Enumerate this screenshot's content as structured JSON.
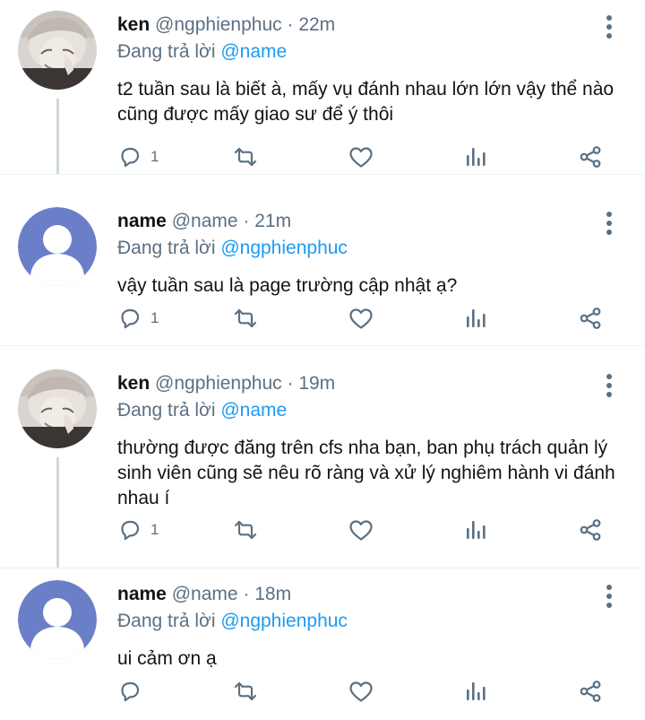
{
  "colors": {
    "accent": "#1d9bf0",
    "muted": "#5b7083",
    "thread_line": "#cfd9de"
  },
  "tweets": [
    {
      "name": "ken",
      "handle": "@ngphienphuc",
      "separator": "·",
      "time": "22m",
      "reply_prefix": "Đang trả lời",
      "reply_to": "@name",
      "text": "t2 tuần sau là biết à, mấy vụ đánh nhau lớn lớn vậy thể nào cũng được mấy giao sư để ý thôi",
      "reply_count": "1",
      "avatar": "photo-avatar"
    },
    {
      "name": "name",
      "handle": "@name",
      "separator": "·",
      "time": "21m",
      "reply_prefix": "Đang trả lời",
      "reply_to": "@ngphienphuc",
      "text": "vậy tuần sau là page trường cập nhật ạ?",
      "reply_count": "1",
      "avatar": "default-avatar"
    },
    {
      "name": "ken",
      "handle": "@ngphienphuc",
      "separator": "·",
      "time": "19m",
      "reply_prefix": "Đang trả lời",
      "reply_to": "@name",
      "text": "thường được đăng trên cfs nha bạn, ban phụ trách quản lý sinh viên cũng sẽ nêu rõ ràng và xử lý nghiêm hành vi đánh nhau í",
      "reply_count": "1",
      "avatar": "photo-avatar"
    },
    {
      "name": "name",
      "handle": "@name",
      "separator": "·",
      "time": "18m",
      "reply_prefix": "Đang trả lời",
      "reply_to": "@ngphienphuc",
      "text": "ui cảm ơn ạ",
      "reply_count": "",
      "avatar": "default-avatar"
    }
  ],
  "action_icons": [
    "reply-icon",
    "retweet-icon",
    "like-icon",
    "analytics-icon",
    "share-icon"
  ]
}
